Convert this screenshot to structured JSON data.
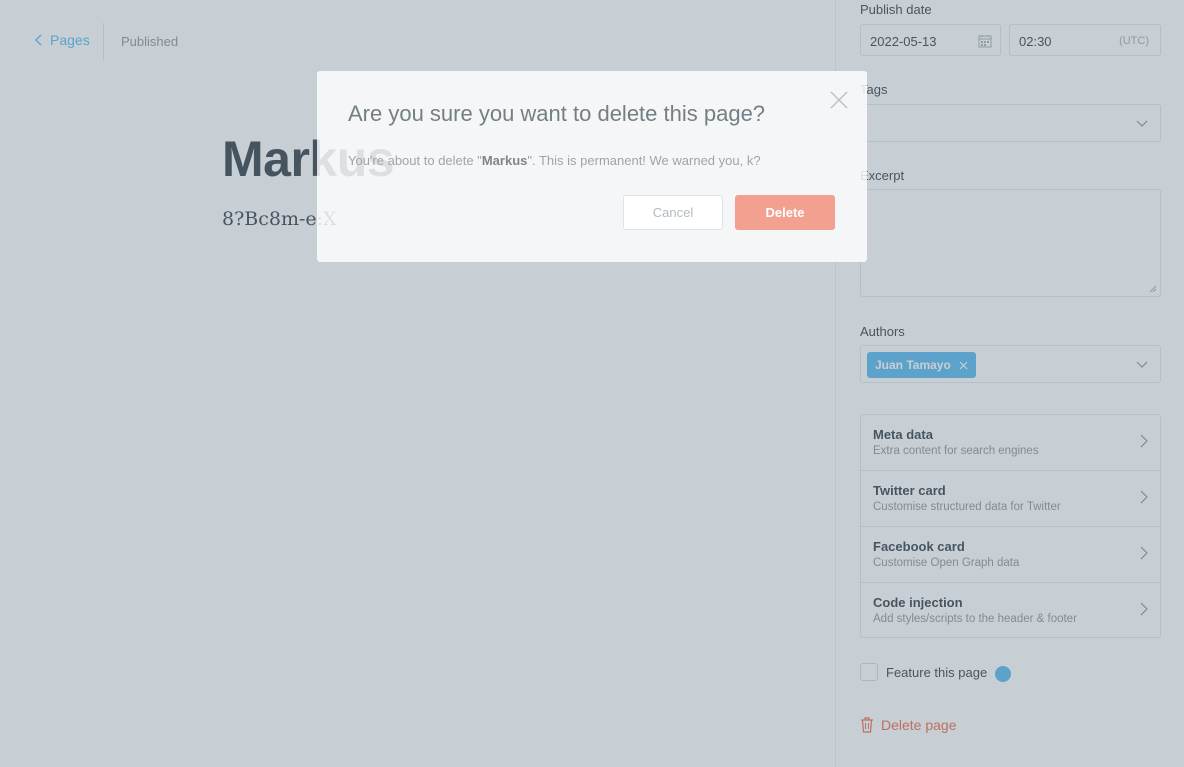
{
  "editor": {
    "back_label": "Pages",
    "status": "Published",
    "title": "Markus",
    "body": "8?Bc8m-e:X"
  },
  "sidebar": {
    "publish_date_label": "Publish date",
    "date_value": "2022-05-13",
    "time_value": "02:30",
    "timezone": "(UTC)",
    "tags_label": "Tags",
    "excerpt_label": "Excerpt",
    "authors_label": "Authors",
    "author_tag": "Juan Tamayo",
    "menu": [
      {
        "title": "Meta data",
        "subtitle": "Extra content for search engines"
      },
      {
        "title": "Twitter card",
        "subtitle": "Customise structured data for Twitter"
      },
      {
        "title": "Facebook card",
        "subtitle": "Customise Open Graph data"
      },
      {
        "title": "Code injection",
        "subtitle": "Add styles/scripts to the header & footer"
      }
    ],
    "feature_label": "Feature this page",
    "delete_label": "Delete page"
  },
  "modal": {
    "title": "Are you sure you want to delete this page?",
    "text_prefix": "You're about to delete \"",
    "text_name": "Markus",
    "text_suffix": "\". This is permanent! We warned you, k?",
    "cancel_label": "Cancel",
    "delete_label": "Delete"
  },
  "colors": {
    "accent": "#3eb0ef",
    "danger": "#f05230",
    "overlay": "#8292a0"
  },
  "icons": [
    "chevron-left-icon",
    "calendar-icon",
    "chevron-down-icon",
    "close-icon",
    "chevron-right-icon",
    "trash-icon"
  ]
}
